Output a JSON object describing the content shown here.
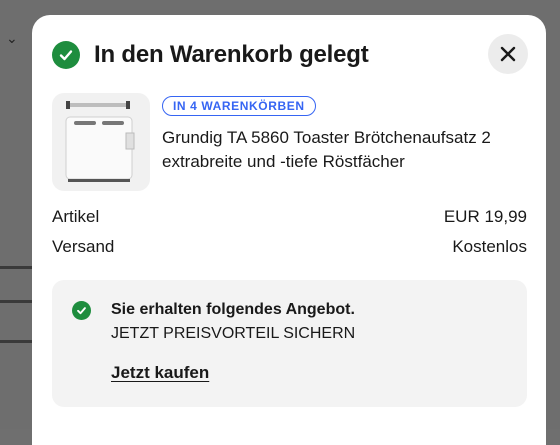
{
  "dialog": {
    "title": "In den Warenkorb gelegt",
    "close_icon": "close-icon",
    "success_icon": "check-circle-icon"
  },
  "product": {
    "badge": "IN 4 WARENKÖRBEN",
    "title": "Grundig TA 5860 Toaster Brötchenaufsatz 2 extrabreite und -tiefe Röstfächer"
  },
  "summary": {
    "items_label": "Artikel",
    "items_value": "EUR 19,99",
    "shipping_label": "Versand",
    "shipping_value": "Kostenlos"
  },
  "offer": {
    "heading": "Sie erhalten folgendes Angebot.",
    "subtext": "JETZT PREISVORTEIL SICHERN",
    "link_label": "Jetzt kaufen"
  },
  "colors": {
    "success": "#1e8d3e",
    "badge_blue": "#3665f3"
  }
}
